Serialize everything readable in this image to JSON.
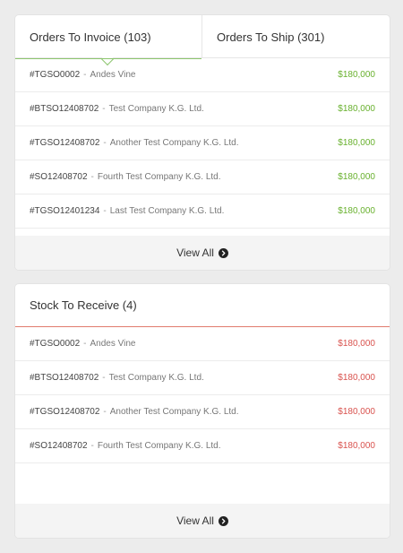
{
  "invoice_panel": {
    "tabs": [
      {
        "label": "Orders To Invoice (103)"
      },
      {
        "label": "Orders To Ship (301)"
      }
    ],
    "rows": [
      {
        "id": "#TGSO0002",
        "company": "Andes Vine",
        "amount": "$180,000"
      },
      {
        "id": "#BTSO12408702",
        "company": "Test Company K.G. Ltd.",
        "amount": "$180,000"
      },
      {
        "id": "#TGSO12408702",
        "company": "Another Test Company K.G. Ltd.",
        "amount": "$180,000"
      },
      {
        "id": "#SO12408702",
        "company": "Fourth Test Company K.G. Ltd.",
        "amount": "$180,000"
      },
      {
        "id": "#TGSO12401234",
        "company": "Last Test Company K.G. Ltd.",
        "amount": "$180,000"
      }
    ],
    "separator": "-",
    "view_all_label": "View All",
    "amount_color": "#69b12f",
    "accent_color": "#8cc56d"
  },
  "stock_panel": {
    "title": "Stock To Receive (4)",
    "rows": [
      {
        "id": "#TGSO0002",
        "company": "Andes Vine",
        "amount": "$180,000"
      },
      {
        "id": "#BTSO12408702",
        "company": "Test Company K.G. Ltd.",
        "amount": "$180,000"
      },
      {
        "id": "#TGSO12408702",
        "company": "Another Test Company K.G. Ltd.",
        "amount": "$180,000"
      },
      {
        "id": "#SO12408702",
        "company": "Fourth Test Company K.G. Ltd.",
        "amount": "$180,000"
      }
    ],
    "separator": "-",
    "view_all_label": "View All",
    "amount_color": "#d9534f",
    "accent_color": "#e07c6e"
  },
  "icons": {
    "view_all": "chevron-right-circle-icon"
  }
}
